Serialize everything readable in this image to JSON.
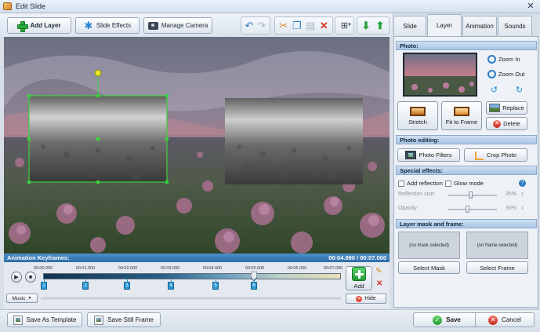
{
  "window": {
    "title": "Edit Slide",
    "close_glyph": "✕"
  },
  "toolbar": {
    "add_layer": "Add Layer",
    "slide_effects": "Slide Effects",
    "manage_camera": "Manage Camera"
  },
  "keyframes": {
    "header": "Animation Keyframes:",
    "time": "00:04.990 / 00:07.000",
    "ticks": [
      "00:00.000",
      "00:01.000",
      "00:02.000",
      "00:03.000",
      "00:04.000",
      "00:05.000",
      "00:06.000",
      "00:07.000"
    ],
    "markers": [
      "1",
      "2",
      "3",
      "4",
      "5",
      "6"
    ],
    "add_label": "Add",
    "music_label": "Music",
    "hide_label": "Hide"
  },
  "bottom": {
    "save_template": "Save As Template",
    "save_still": "Save Still Frame",
    "save": "Save",
    "cancel": "Cancel"
  },
  "tabs": [
    "Slide",
    "Layer",
    "Animation",
    "Sounds"
  ],
  "active_tab": "Layer",
  "panel": {
    "photo_head": "Photo:",
    "zoom_in": "Zoom In",
    "zoom_out": "Zoom Out",
    "replace": "Replace",
    "delete": "Delete",
    "stretch": "Stretch",
    "fit_to_frame": "Fit to Frame",
    "photo_editing_head": "Photo editing:",
    "photo_filters": "Photo Filters",
    "crop_photo": "Crop Photo",
    "special_effects_head": "Special effects:",
    "add_reflection": "Add reflection",
    "glow_mode": "Glow mode",
    "reflection_size_label": "Reflection size:",
    "reflection_size_value": "35%",
    "opacity_label": "Opacity:",
    "opacity_value": "30%",
    "mask_head": "Layer mask and frame:",
    "no_mask": "(no mask selected)",
    "no_frame": "(no frame selected)",
    "select_mask": "Select Mask",
    "select_frame": "Select Frame"
  },
  "colors": {
    "accent": "#2f6ea8",
    "selection": "#39d23c",
    "header_bar": "#4d8fcc"
  }
}
